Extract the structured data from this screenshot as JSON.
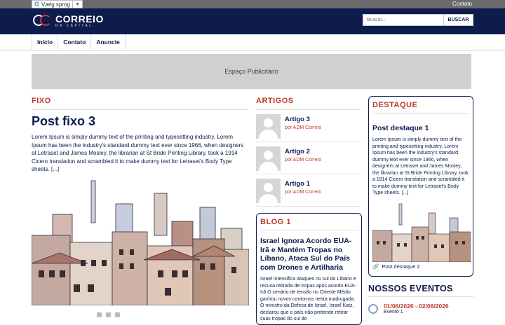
{
  "topbar": {
    "translate_label": "Vælg sprog",
    "translate_arrow": "▼",
    "contact": "Contato"
  },
  "header": {
    "logo_name": "CORREIO",
    "logo_sub": "DA CAPITAL",
    "search_placeholder": "Buscar...",
    "search_button": "BUSCAR"
  },
  "nav": {
    "items": [
      "Início",
      "Contato",
      "Anuncie"
    ]
  },
  "ad": {
    "label": "Espaço Publicitário"
  },
  "fixo": {
    "section": "FIXO",
    "title": "Post fixo 3",
    "excerpt": "Lorem Ipsum is simply dummy text of the printing and typesetting industry. Lorem Ipsum has been the industry's standard dummy text ever since 1966, when designers at Letraset and James Mosley, the librarian at St Bride Printing Library, took a 1914 Cicero translation and scrambled it to make dummy text for Letraset's Body Type sheets. [...]"
  },
  "artigos": {
    "section": "ARTIGOS",
    "items": [
      {
        "title": "Artigo 3",
        "author": "por ADM Correio"
      },
      {
        "title": "Artigo 2",
        "author": "por ADM Correio"
      },
      {
        "title": "Artigo 1",
        "author": "por ADM Correio"
      }
    ]
  },
  "blog": {
    "section": "BLOG 1",
    "title": "Israel Ignora Acordo EUA-Irã e Mantém Tropas no Líbano, Ataca Sul do País com Drones e Artilharia",
    "excerpt": "Israel intensifica ataques no sul do Líbano e recusa retirada de tropas após acordo EUA-Irã O cenário de tensão no Oriente Médio ganhou novos contornos nesta madrugada. O ministro da Defesa de Israel, Israel Katz, declarou que o país não pretende retirar suas tropas do sul do"
  },
  "destaque": {
    "section": "DESTAQUE",
    "title": "Post destaque 1",
    "excerpt": "Lorem Ipsum is simply dummy text of the printing and typesetting industry. Lorem Ipsum has been the industry's standard dummy text ever since 1966, when designers at Letraset and James Mosley, the librarian at St Bride Printing Library, took a 1914 Cicero translation and scrambled it to make dummy text for Letraset's Body Type sheets. [...]",
    "link": "Post destaque 2"
  },
  "eventos": {
    "section": "NOSSOS EVENTOS",
    "date": "01/06/2026 - 02/06/2026",
    "event": "Evento 1"
  },
  "colors": {
    "navy": "#0e1b4d",
    "accent_red": "#c0392b",
    "ad_gray": "#d0d0d0"
  }
}
